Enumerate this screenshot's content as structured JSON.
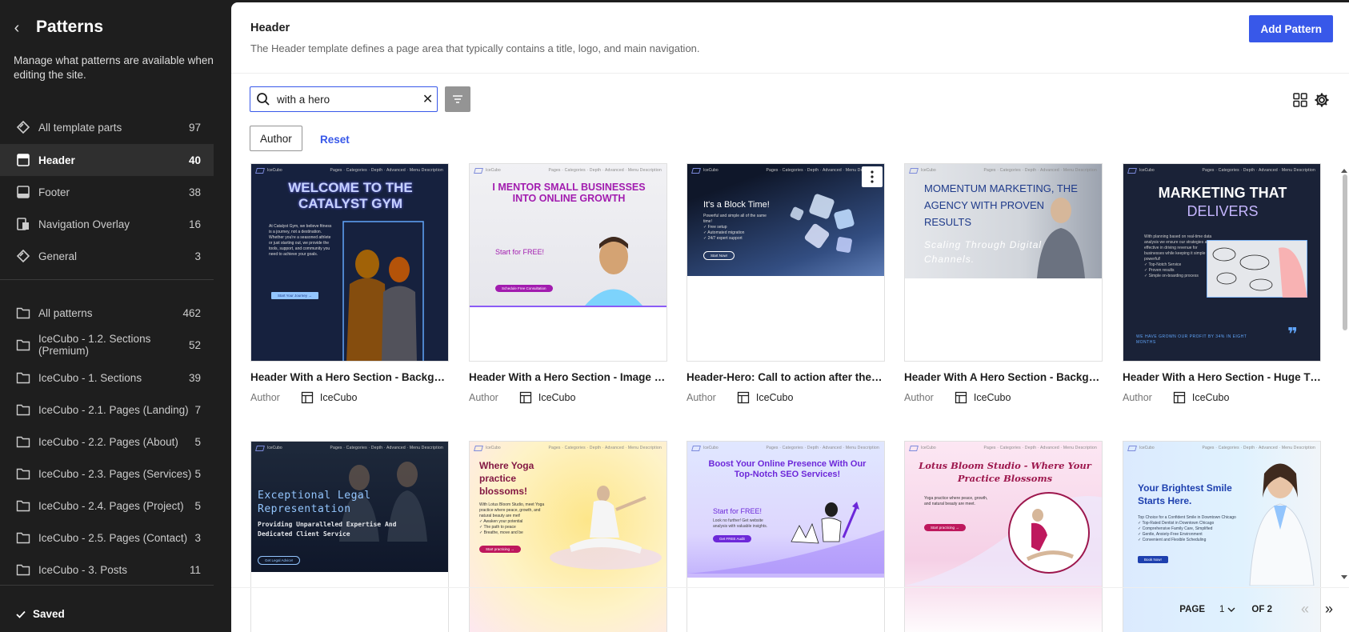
{
  "sidebar": {
    "title": "Patterns",
    "description": "Manage what patterns are available when editing the site.",
    "template_parts": [
      {
        "label": "All template parts",
        "count": "97",
        "icon": "diamond-icon"
      },
      {
        "label": "Header",
        "count": "40",
        "icon": "header-icon",
        "active": true
      },
      {
        "label": "Footer",
        "count": "38",
        "icon": "footer-icon"
      },
      {
        "label": "Navigation Overlay",
        "count": "16",
        "icon": "overlay-icon"
      },
      {
        "label": "General",
        "count": "3",
        "icon": "diamond-icon"
      }
    ],
    "categories": [
      {
        "label": "All patterns",
        "count": "462"
      },
      {
        "label": "IceCubo - 1.2. Sections (Premium)",
        "count": "52"
      },
      {
        "label": "IceCubo - 1. Sections",
        "count": "39"
      },
      {
        "label": "IceCubo - 2.1. Pages (Landing)",
        "count": "7"
      },
      {
        "label": "IceCubo - 2.2. Pages (About)",
        "count": "5"
      },
      {
        "label": "IceCubo - 2.3. Pages (Services)",
        "count": "5"
      },
      {
        "label": "IceCubo - 2.4. Pages (Project)",
        "count": "5"
      },
      {
        "label": "IceCubo - 2.5. Pages (Contact)",
        "count": "3"
      },
      {
        "label": "IceCubo - 3. Posts",
        "count": "11"
      }
    ],
    "saved_label": "Saved"
  },
  "header": {
    "title": "Header",
    "description": "The Header template defines a page area that typically contains a title, logo, and main navigation.",
    "add_button": "Add Pattern"
  },
  "toolbar": {
    "search_value": "with a hero",
    "filter_chip": "Author",
    "reset_label": "Reset"
  },
  "patterns": [
    {
      "title": "Header With a Hero Section - Backgro...",
      "author_label": "Author",
      "author": "IceCubo",
      "art": {
        "heading": "WELCOME TO THE CATALYST GYM",
        "button": "Start Your Journey →"
      }
    },
    {
      "title": "Header With a Hero Section - Image o...",
      "author_label": "Author",
      "author": "IceCubo",
      "art": {
        "heading": "I MENTOR SMALL BUSINESSES INTO ONLINE GROWTH",
        "sub": "Start for FREE!",
        "button": "Schedule Free Consultation"
      }
    },
    {
      "title": "Header-Hero: Call to action after the li...",
      "author_label": "Author",
      "author": "IceCubo",
      "art": {
        "heading": "It's a Block Time!",
        "button": "Start Now!"
      }
    },
    {
      "title": "Header With A Hero Section - Backgro...",
      "author_label": "Author",
      "author": "IceCubo",
      "art": {
        "heading": "MOMENTUM MARKETING, THE AGENCY WITH PROVEN RESULTS",
        "sub": "Scaling Through Digital Channels."
      }
    },
    {
      "title": "Header With a Hero Section - Huge Tit...",
      "author_label": "Author",
      "author": "IceCubo",
      "art": {
        "heading": "MARKETING THAT",
        "heading2": "DELIVERS",
        "footer": "WE HAVE GROWN OUR PROFIT BY 34% IN EIGHT MONTHS"
      }
    },
    {
      "title": "",
      "author_label": "",
      "author": "",
      "art": {
        "heading": "Exceptional Legal Representation",
        "sub": "Providing Unparalleled Expertise And Dedicated Client Service",
        "button": "Get Legal Advice!"
      }
    },
    {
      "title": "",
      "author_label": "",
      "author": "",
      "art": {
        "heading": "Where Yoga practice blossoms!",
        "button": "Start practicing →"
      }
    },
    {
      "title": "",
      "author_label": "",
      "author": "",
      "art": {
        "heading": "Boost Your Online Presence With Our Top-Notch SEO Services!",
        "sub": "Start for FREE!",
        "button": "Get FREE Audit"
      }
    },
    {
      "title": "",
      "author_label": "",
      "author": "",
      "art": {
        "heading": "Lotus Bloom Studio - Where Your Practice Blossoms",
        "button": "Start practicing →"
      }
    },
    {
      "title": "",
      "author_label": "",
      "author": "",
      "art": {
        "heading": "Your Brightest Smile Starts Here.",
        "button": "Book Now!"
      }
    }
  ],
  "mini_nav": {
    "logo": "IceCubo",
    "links": "Pages ·  Categories ·  Depth ·  Advanced ·  Menu Description"
  },
  "pagination": {
    "page_label": "PAGE",
    "page": "1",
    "of_label": "OF 2"
  },
  "colors": {
    "accent": "#3858e9",
    "sidebar_bg": "#1e1e1e"
  }
}
